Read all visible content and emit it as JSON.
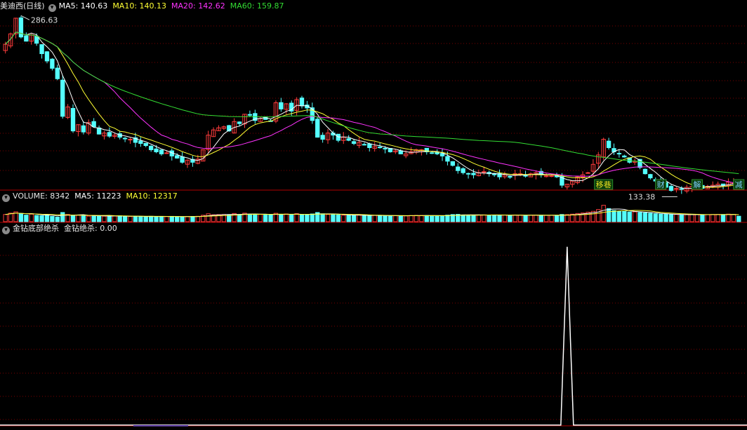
{
  "main_header": {
    "title": "美迪西(日线)",
    "ma5": "MA5: 140.63",
    "ma10": "MA10: 140.13",
    "ma20": "MA20: 142.62",
    "ma60": "MA60: 159.87"
  },
  "vol_header": {
    "label": "VOLUME: 8342",
    "ma5": "MA5: 11223",
    "ma10": "MA10: 12317"
  },
  "ind_header": {
    "label": "金钻底部绝杀",
    "value": "金钻绝杀: 0.00"
  },
  "colors": {
    "up": "#ff3c3c",
    "down": "#54ffff",
    "ma5": "#ffffff",
    "ma10": "#ffff33",
    "ma20": "#ff33ff",
    "ma60": "#33dd33",
    "grid": "#7a0000",
    "separator": "#b00000",
    "signal": "#ffffff"
  },
  "chart_data": {
    "type": "candlestick",
    "high_label": "286.63",
    "low_label": "133.38",
    "price_range": [
      126,
      296
    ],
    "ohlc_closes": [
      265,
      275,
      290,
      272,
      268,
      274,
      266,
      256,
      249,
      242,
      232,
      196,
      205,
      182,
      188,
      181,
      190,
      186,
      179,
      180,
      177,
      178,
      176,
      175,
      174,
      171,
      170,
      168,
      164,
      162,
      160,
      161,
      158,
      156,
      152,
      154,
      152,
      155,
      164,
      178,
      183,
      185,
      186,
      182,
      191,
      189,
      198,
      197,
      192,
      194,
      193,
      191,
      209,
      203,
      208,
      201,
      212,
      206,
      204,
      192,
      176,
      174,
      180,
      178,
      173,
      176,
      173,
      170,
      171,
      169,
      166,
      167,
      166,
      165,
      162,
      163,
      160,
      160,
      162,
      164,
      164,
      162,
      161,
      160,
      158,
      153,
      149,
      144,
      142,
      141,
      140,
      142,
      143,
      141,
      140,
      138,
      140,
      138,
      141,
      141,
      139,
      141,
      142,
      140,
      139,
      139,
      138,
      130,
      131,
      134,
      138,
      140,
      142,
      150,
      159,
      174,
      166,
      162,
      160,
      157,
      152,
      153,
      147,
      141,
      137,
      134,
      131,
      128,
      125,
      127,
      126,
      128,
      129,
      130,
      127,
      129,
      130,
      131,
      130,
      133,
      132,
      131
    ],
    "events": [
      "移巷",
      "财",
      "解",
      "减"
    ],
    "volume": {
      "range": [
        0,
        30000
      ],
      "values": [
        11000,
        13000,
        15000,
        12000,
        10000,
        11500,
        9500,
        9000,
        10500,
        8000,
        7000,
        14000,
        11000,
        9500,
        10000,
        9000,
        8500,
        8800,
        9200,
        8400,
        8000,
        8800,
        9000,
        8300,
        7900,
        8100,
        7700,
        7600,
        8200,
        8000,
        7900,
        7800,
        8100,
        7600,
        7400,
        7800,
        8000,
        8200,
        9800,
        12000,
        10500,
        10800,
        11000,
        10200,
        12500,
        11000,
        13000,
        11500,
        10800,
        11200,
        10600,
        10300,
        12800,
        10900,
        11800,
        10400,
        12200,
        10900,
        10500,
        11800,
        14000,
        12000,
        11000,
        10800,
        10400,
        10000,
        9800,
        9600,
        10200,
        9400,
        9300,
        9500,
        9200,
        9100,
        9000,
        9100,
        8900,
        8900,
        9400,
        9600,
        9500,
        9400,
        9200,
        9000,
        8900,
        10000,
        10900,
        11200,
        10300,
        10100,
        9900,
        10200,
        10400,
        10100,
        9900,
        9800,
        10100,
        9700,
        10200,
        10000,
        9700,
        9900,
        10000,
        9800,
        9600,
        9700,
        9500,
        11000,
        10800,
        11500,
        12500,
        13200,
        14500,
        15800,
        18500,
        25000,
        20000,
        17000,
        16000,
        15500,
        14800,
        15000,
        14000,
        13500,
        12800,
        12000,
        11500,
        11200,
        10800,
        11000,
        10500,
        10700,
        10800,
        11000,
        10400,
        10800,
        11000,
        11100,
        10900,
        11500,
        11000,
        8342
      ],
      "ma5": 11223,
      "ma10": 12317
    },
    "indicator": {
      "name": "金钻绝杀",
      "current": 0.0,
      "spike_index": 108,
      "spike_value": 1,
      "range": [
        0,
        1.07
      ]
    }
  }
}
